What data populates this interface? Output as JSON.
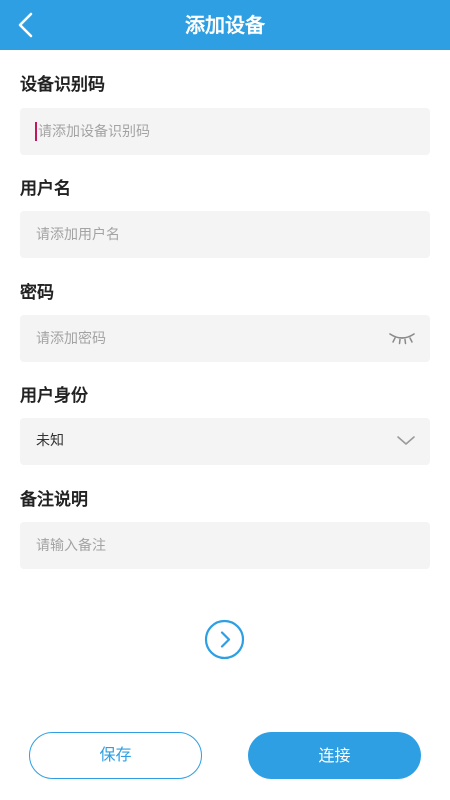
{
  "header": {
    "title": "添加设备"
  },
  "form": {
    "device_code": {
      "label": "设备识别码",
      "placeholder": "请添加设备识别码"
    },
    "username": {
      "label": "用户名",
      "placeholder": "请添加用户名"
    },
    "password": {
      "label": "密码",
      "placeholder": "请添加密码"
    },
    "identity": {
      "label": "用户身份",
      "value": "未知"
    },
    "remark": {
      "label": "备注说明",
      "placeholder": "请输入备注"
    }
  },
  "buttons": {
    "save": "保存",
    "connect": "连接"
  },
  "icons": {
    "back": "chevron-left-icon",
    "password_toggle": "eye-closed-icon",
    "identity_dropdown": "chevron-down-icon",
    "next": "circle-chevron-right-icon"
  },
  "colors": {
    "primary": "#2e9fe2",
    "field_bg": "#f4f4f4",
    "caret": "#c2185b"
  }
}
